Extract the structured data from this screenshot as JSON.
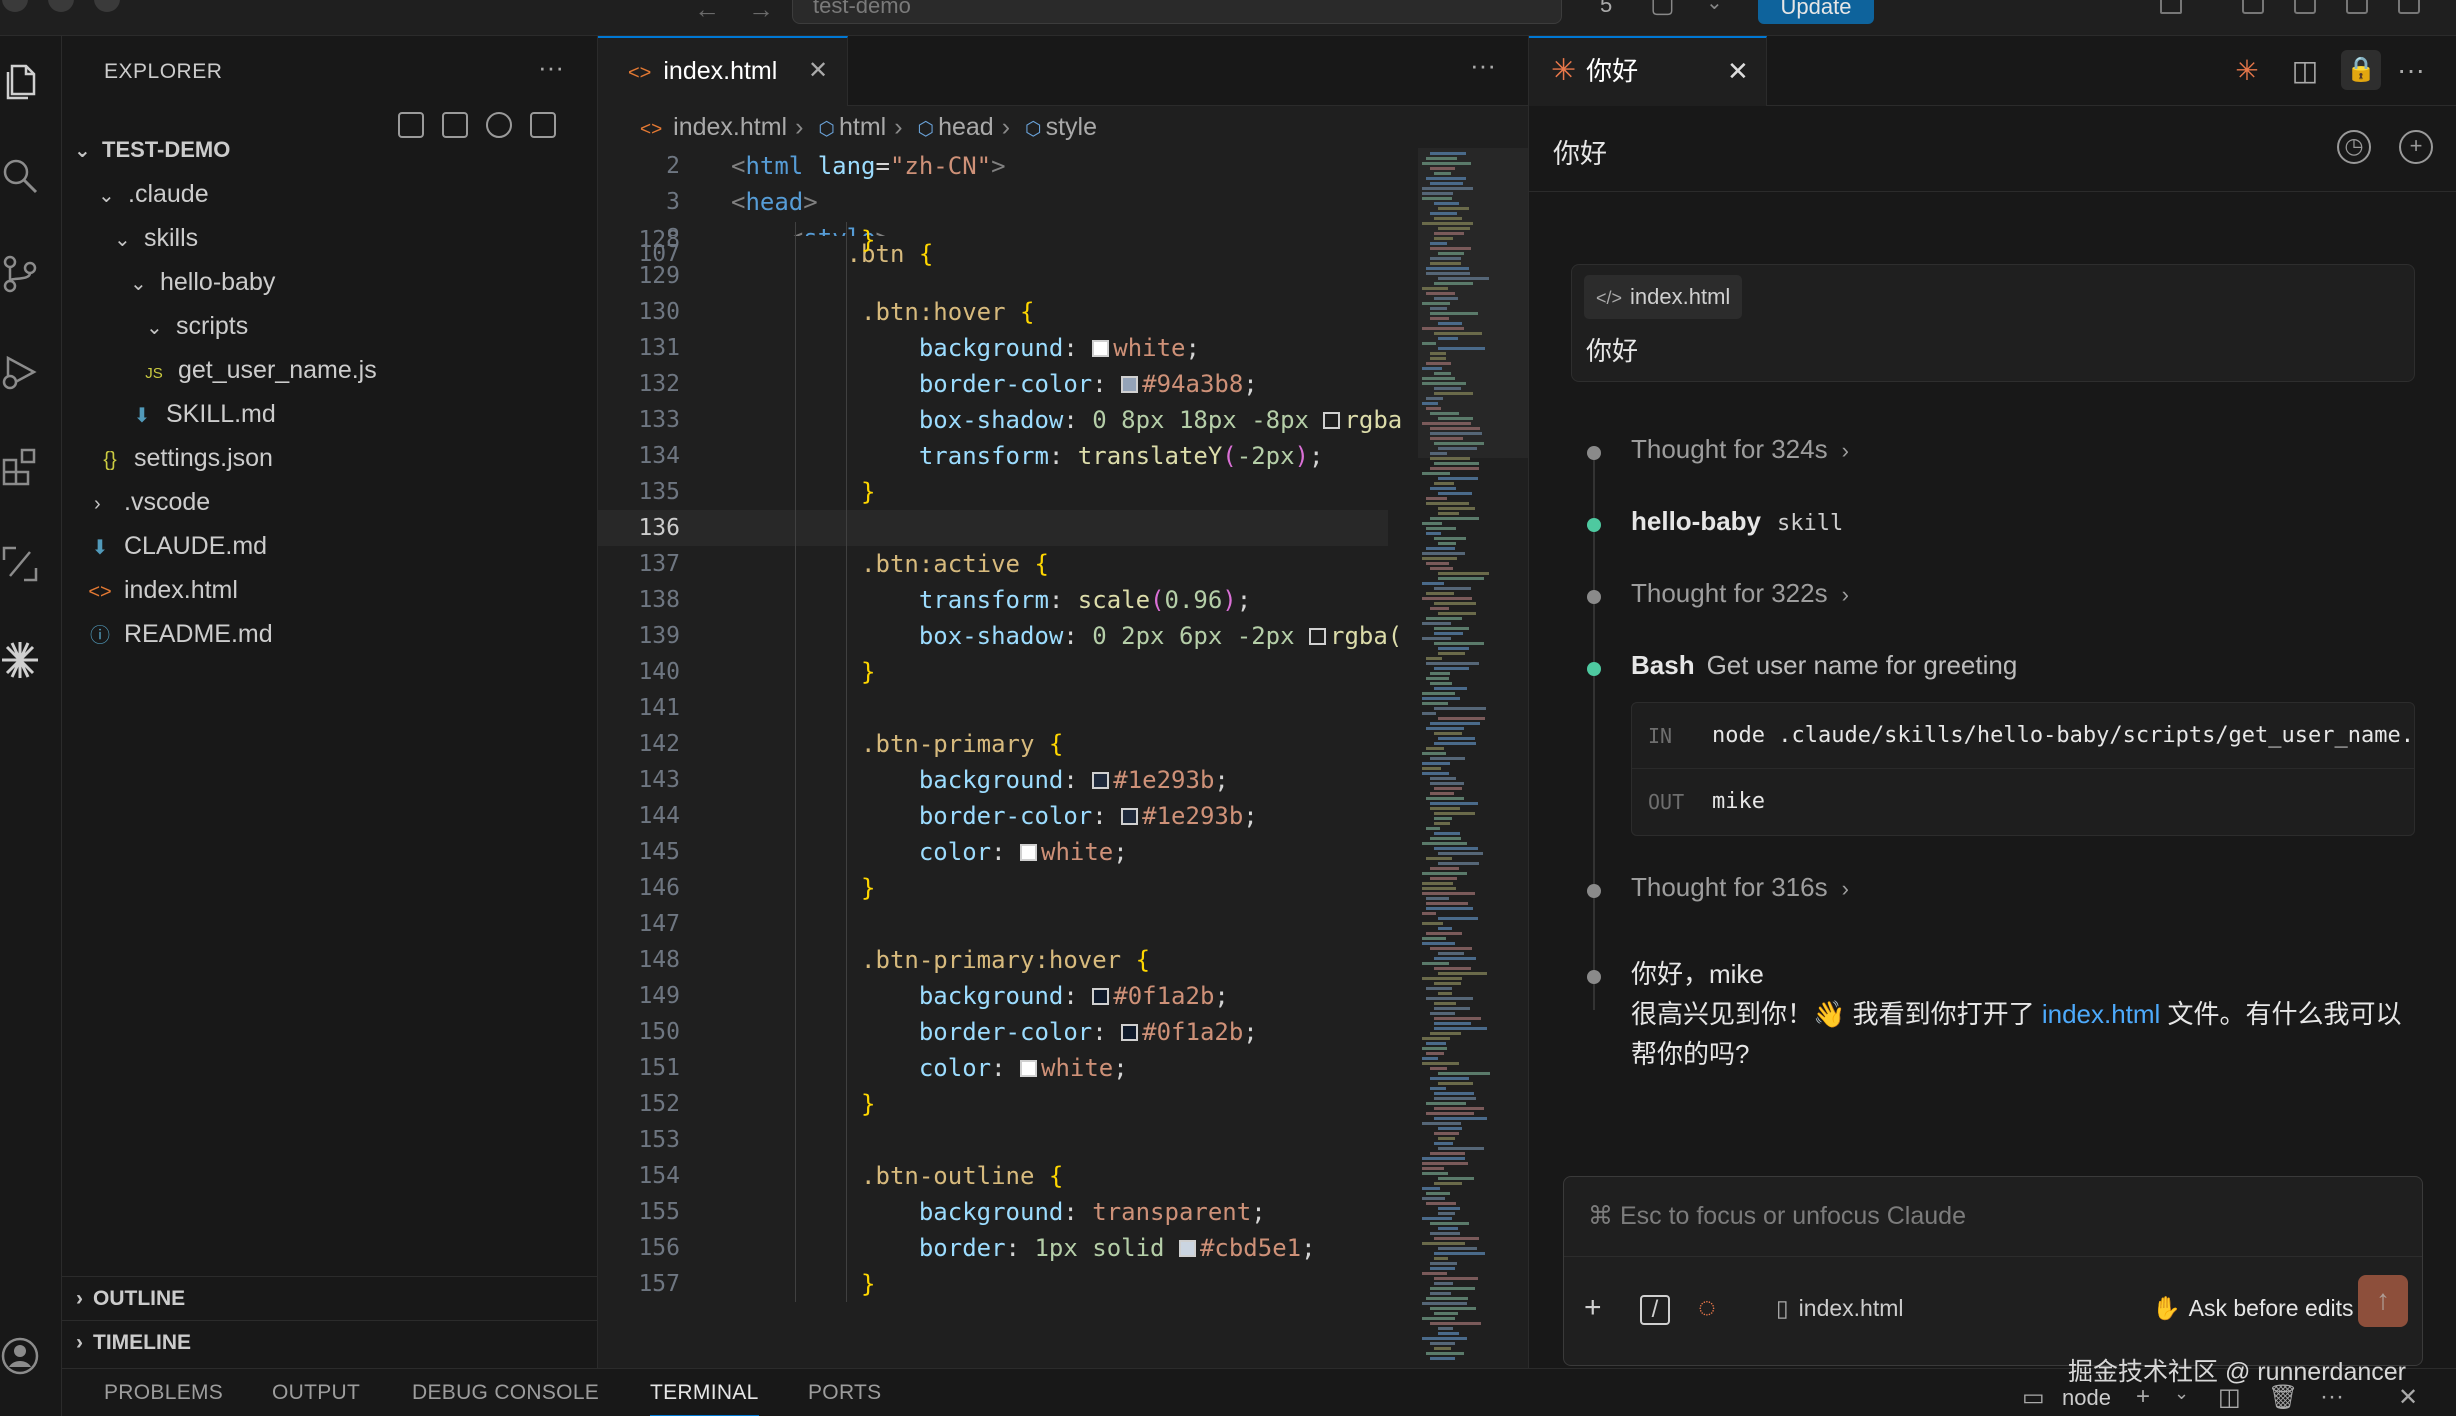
{
  "titlebar": {
    "search_text": "test-demo",
    "notification_count": "5",
    "update_label": "Update"
  },
  "activitybar": {
    "items": [
      "explorer-icon",
      "search-icon",
      "source-control-icon",
      "run-debug-icon",
      "extensions-icon",
      "remote-icon",
      "claude-icon",
      "account-icon"
    ]
  },
  "sidebar": {
    "title": "EXPLORER",
    "more": "···",
    "project": "TEST-DEMO",
    "tree": [
      {
        "label": ".claude",
        "icon": "",
        "chev": "⌄"
      },
      {
        "label": "skills",
        "icon": "",
        "chev": "⌄"
      },
      {
        "label": "hello-baby",
        "icon": "",
        "chev": "⌄"
      },
      {
        "label": "scripts",
        "icon": "",
        "chev": "⌄"
      },
      {
        "label": "get_user_name.js",
        "icon": "JS",
        "chev": ""
      },
      {
        "label": "SKILL.md",
        "icon": "⬇",
        "chev": ""
      },
      {
        "label": "settings.json",
        "icon": "{}",
        "chev": ""
      },
      {
        "label": ".vscode",
        "icon": "",
        "chev": "›"
      },
      {
        "label": "CLAUDE.md",
        "icon": "⬇",
        "chev": ""
      },
      {
        "label": "index.html",
        "icon": "<>",
        "chev": ""
      },
      {
        "label": "README.md",
        "icon": "ⓘ",
        "chev": ""
      }
    ],
    "outline": "OUTLINE",
    "timeline": "TIMELINE"
  },
  "editor": {
    "tab_label": "index.html",
    "more": "···",
    "breadcrumb": [
      "index.html",
      "html",
      "head",
      "style"
    ],
    "sticky": [
      {
        "ln": "2",
        "html": "html"
      },
      {
        "ln": "3",
        "html": "head"
      },
      {
        "ln": "8",
        "html": "style"
      },
      {
        "ln": "107",
        "html": "btnpeek"
      }
    ],
    "lines": [
      {
        "ln": "128",
        "t": "close"
      },
      {
        "ln": "129",
        "t": "blank"
      },
      {
        "ln": "130",
        "t": "sel",
        "sel": ".btn:hover"
      },
      {
        "ln": "131",
        "t": "prop",
        "p": "background",
        "sw": "#ffffff",
        "v": "white"
      },
      {
        "ln": "132",
        "t": "prop",
        "p": "border-color",
        "sw": "#94a3b8",
        "v": "#94a3b8"
      },
      {
        "ln": "133",
        "t": "raw",
        "code": "box-shadow: 0 8px 18px -8px",
        "tail": "rgba"
      },
      {
        "ln": "134",
        "t": "transform",
        "code": "transform: translateY(-2px);"
      },
      {
        "ln": "135",
        "t": "close"
      },
      {
        "ln": "136",
        "t": "blank",
        "cur": true
      },
      {
        "ln": "137",
        "t": "sel",
        "sel": ".btn:active"
      },
      {
        "ln": "138",
        "t": "transform",
        "code": "transform: scale(0.96);"
      },
      {
        "ln": "139",
        "t": "raw",
        "code": "box-shadow: 0 2px 6px -2px",
        "tail": "rgba("
      },
      {
        "ln": "140",
        "t": "close"
      },
      {
        "ln": "141",
        "t": "blank"
      },
      {
        "ln": "142",
        "t": "sel",
        "sel": ".btn-primary"
      },
      {
        "ln": "143",
        "t": "prop",
        "p": "background",
        "sw": "#1e293b",
        "v": "#1e293b"
      },
      {
        "ln": "144",
        "t": "prop",
        "p": "border-color",
        "sw": "#1e293b",
        "v": "#1e293b"
      },
      {
        "ln": "145",
        "t": "prop",
        "p": "color",
        "sw": "#ffffff",
        "v": "white"
      },
      {
        "ln": "146",
        "t": "close"
      },
      {
        "ln": "147",
        "t": "blank"
      },
      {
        "ln": "148",
        "t": "sel",
        "sel": ".btn-primary:hover"
      },
      {
        "ln": "149",
        "t": "prop",
        "p": "background",
        "sw": "#0f1a2b",
        "v": "#0f1a2b"
      },
      {
        "ln": "150",
        "t": "prop",
        "p": "border-color",
        "sw": "#0f1a2b",
        "v": "#0f1a2b"
      },
      {
        "ln": "151",
        "t": "prop",
        "p": "color",
        "sw": "#ffffff",
        "v": "white"
      },
      {
        "ln": "152",
        "t": "close"
      },
      {
        "ln": "153",
        "t": "blank"
      },
      {
        "ln": "154",
        "t": "sel",
        "sel": ".btn-outline"
      },
      {
        "ln": "155",
        "t": "prop",
        "p": "background",
        "v": "transparent"
      },
      {
        "ln": "156",
        "t": "prop",
        "p": "border",
        "pre": "1px solid ",
        "sw": "#cbd5e1",
        "v": "#cbd5e1"
      },
      {
        "ln": "157",
        "t": "close"
      }
    ]
  },
  "claude": {
    "tab_label": "你好",
    "chat_title": "你好",
    "user_message": {
      "file": "index.html",
      "text": "你好"
    },
    "steps": {
      "thought1": "Thought for 324s",
      "skill_name": "hello-baby",
      "skill_tag": "skill",
      "thought2": "Thought for 322s",
      "bash_label": "Bash",
      "bash_desc": "Get user name for greeting",
      "in_label": "IN",
      "in_cmd": "node .claude/skills/hello-baby/scripts/get_user_name.js",
      "out_label": "OUT",
      "out_val": "mike",
      "thought3": "Thought for 316s"
    },
    "reply": {
      "line1": "你好，mike",
      "line2_pre": "很高兴见到你！👋 我看到你打开了 ",
      "link": "index.html",
      "line2_post": " 文件。有什么我可以帮你的吗?"
    },
    "input": {
      "placeholder": "⌘ Esc to focus or unfocus Claude",
      "file": "index.html",
      "mode": "Ask before edits"
    },
    "accent": "#e8774a"
  },
  "panel": {
    "tabs": [
      "PROBLEMS",
      "OUTPUT",
      "DEBUG CONSOLE",
      "TERMINAL",
      "PORTS"
    ],
    "active": "TERMINAL",
    "terminal_name": "node"
  },
  "watermark": "掘金技术社区 @ runnerdancer"
}
